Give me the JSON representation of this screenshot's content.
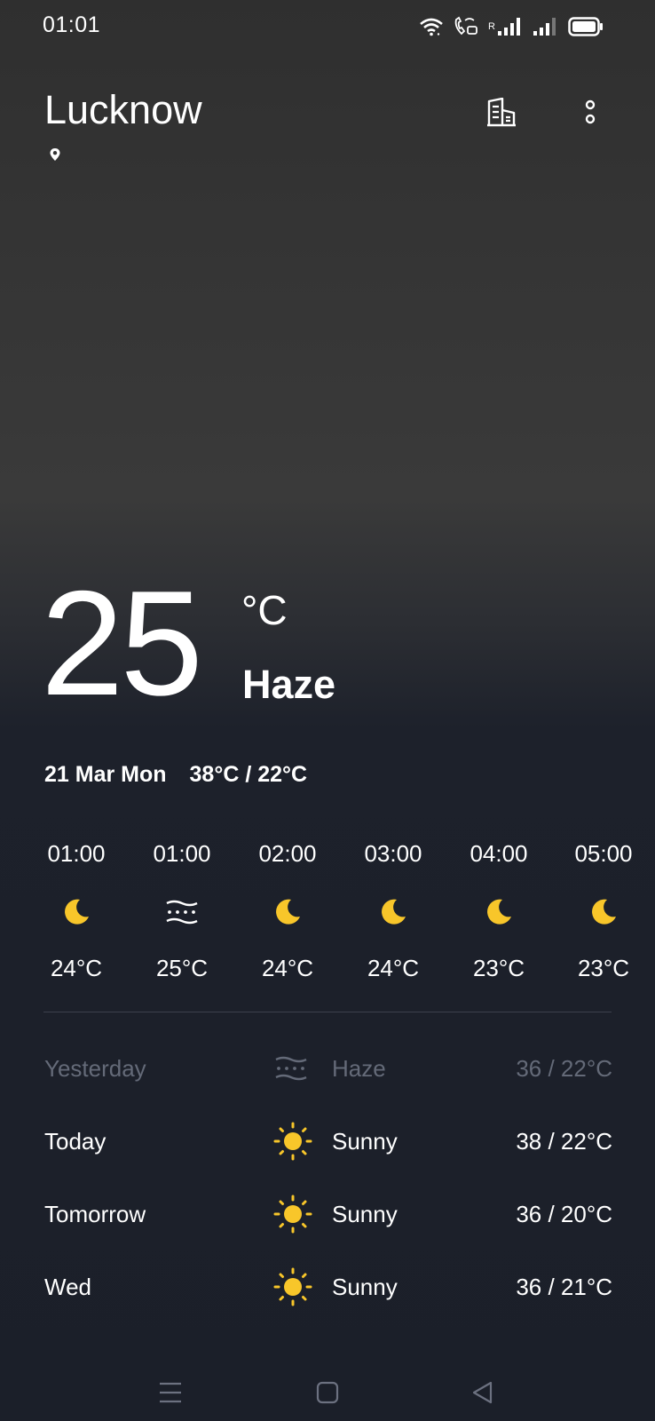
{
  "status_bar": {
    "time": "01:01",
    "roaming_indicator": "R"
  },
  "header": {
    "city": "Lucknow"
  },
  "current": {
    "temperature": "25",
    "unit": "°C",
    "condition": "Haze",
    "date": "21 Mar Mon",
    "high_low": "38°C / 22°C"
  },
  "hourly": [
    {
      "time": "01:00",
      "icon": "moon-icon",
      "temp": "24°C"
    },
    {
      "time": "01:00",
      "icon": "haze-icon",
      "temp": "25°C"
    },
    {
      "time": "02:00",
      "icon": "moon-icon",
      "temp": "24°C"
    },
    {
      "time": "03:00",
      "icon": "moon-icon",
      "temp": "24°C"
    },
    {
      "time": "04:00",
      "icon": "moon-icon",
      "temp": "23°C"
    },
    {
      "time": "05:00",
      "icon": "moon-icon",
      "temp": "23°C"
    }
  ],
  "daily": [
    {
      "day": "Yesterday",
      "icon": "haze-icon",
      "condition": "Haze",
      "range": "36 / 22°C"
    },
    {
      "day": "Today",
      "icon": "sun-icon",
      "condition": "Sunny",
      "range": "38 / 22°C"
    },
    {
      "day": "Tomorrow",
      "icon": "sun-icon",
      "condition": "Sunny",
      "range": "36 / 20°C"
    },
    {
      "day": "Wed",
      "icon": "sun-icon",
      "condition": "Sunny",
      "range": "36 / 21°C"
    }
  ],
  "colors": {
    "accent_yellow": "#f8c62a",
    "muted_text": "#646a78",
    "divider": "#3c414d"
  }
}
